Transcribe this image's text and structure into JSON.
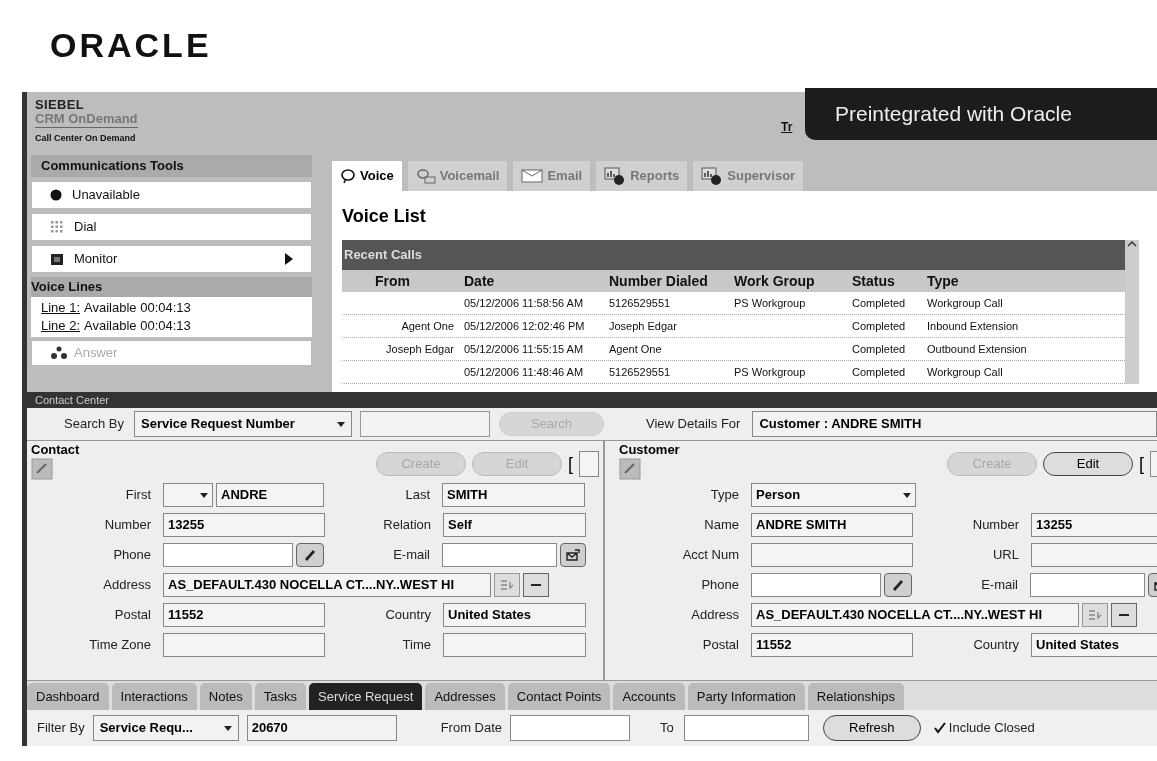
{
  "logo": "ORACLE",
  "header": {
    "brand": "SIEBEL",
    "product": "CRM OnDemand",
    "subtitle": "Call Center On Demand",
    "link_partial": "Tr",
    "banner": "Preintegrated with Oracle"
  },
  "comm_tools": {
    "title": "Communications Tools",
    "items": [
      {
        "label": "Unavailable",
        "kind": "status",
        "submenu": false
      },
      {
        "label": "Dial",
        "kind": "dial",
        "submenu": false
      },
      {
        "label": "Monitor",
        "kind": "monitor",
        "submenu": true
      }
    ]
  },
  "voice_lines": {
    "title": "Voice Lines",
    "lines": [
      {
        "link": "Line 1:",
        "status": "Available 00:04:13"
      },
      {
        "link": "Line 2:",
        "status": "Available 00:04:13"
      }
    ],
    "answer": {
      "label": "Answer",
      "disabled": true
    }
  },
  "tabs": [
    {
      "label": "Voice",
      "kind": "voice",
      "selected": true
    },
    {
      "label": "Voicemail",
      "kind": "voicemail",
      "selected": false
    },
    {
      "label": "Email",
      "kind": "email",
      "selected": false
    },
    {
      "label": "Reports",
      "kind": "reports",
      "selected": false
    },
    {
      "label": "Supervisor",
      "kind": "supervisor",
      "selected": false
    }
  ],
  "voice_list": {
    "title": "Voice List",
    "section": "Recent Calls",
    "columns": [
      "From",
      "Date",
      "Number Dialed",
      "Work Group",
      "Status",
      "Type"
    ],
    "rows": [
      [
        "",
        "05/12/2006 11:58:56 AM",
        "5126529551",
        "PS Workgroup",
        "Completed",
        "Workgroup Call"
      ],
      [
        "Agent One",
        "05/12/2006 12:02:46 PM",
        "Joseph Edgar",
        "",
        "Completed",
        "Inbound Extension"
      ],
      [
        "Joseph Edgar",
        "05/12/2006 11:55:15 AM",
        "Agent One",
        "",
        "Completed",
        "Outbound Extension"
      ],
      [
        "",
        "05/12/2006 11:48:46 AM",
        "5126529551",
        "PS Workgroup",
        "Completed",
        "Workgroup Call"
      ]
    ]
  },
  "contact_center": {
    "title": "Contact Center"
  },
  "search": {
    "label": "Search By",
    "select": "Service Request Number",
    "button": {
      "label": "Search",
      "disabled": true
    },
    "view_label": "View Details For",
    "view_value": "Customer : ANDRE SMITH"
  },
  "contact": {
    "title": "Contact",
    "bracket": "[",
    "buttons": [
      {
        "label": "Create",
        "disabled": true
      },
      {
        "label": "Edit",
        "disabled": true
      }
    ],
    "rows": [
      [
        {
          "label": "First",
          "kind": "name_select",
          "value": "ANDRE"
        },
        {
          "label": "Last",
          "kind": "text",
          "value": "SMITH"
        }
      ],
      [
        {
          "label": "Number",
          "kind": "text",
          "value": "13255"
        },
        {
          "label": "Relation",
          "kind": "text",
          "value": "Self"
        }
      ],
      [
        {
          "label": "Phone",
          "kind": "phone"
        },
        {
          "label": "E-mail",
          "kind": "email"
        }
      ],
      [
        {
          "label": "Address",
          "kind": "address",
          "value": "AS_DEFAULT.430 NOCELLA CT....NY..WEST HI"
        }
      ],
      [
        {
          "label": "Postal",
          "kind": "text",
          "value": "11552"
        },
        {
          "label": "Country",
          "kind": "text",
          "value": "United States"
        }
      ],
      [
        {
          "label": "Time Zone",
          "kind": "text"
        },
        {
          "label": "Time",
          "kind": "text"
        }
      ]
    ]
  },
  "customer": {
    "title": "Customer",
    "bracket": "[",
    "buttons": [
      {
        "label": "Create",
        "disabled": true
      },
      {
        "label": "Edit",
        "disabled": false
      }
    ],
    "rows": [
      [
        {
          "label": "Type",
          "kind": "select",
          "value": "Person"
        }
      ],
      [
        {
          "label": "Name",
          "kind": "text",
          "value": "ANDRE SMITH"
        },
        {
          "label": "Number",
          "kind": "text",
          "value": "13255"
        }
      ],
      [
        {
          "label": "Acct Num",
          "kind": "text"
        },
        {
          "label": "URL",
          "kind": "text"
        }
      ],
      [
        {
          "label": "Phone",
          "kind": "phone"
        },
        {
          "label": "E-mail",
          "kind": "email"
        }
      ],
      [
        {
          "label": "Address",
          "kind": "address",
          "value": "AS_DEFAULT.430 NOCELLA CT....NY..WEST HI"
        }
      ],
      [
        {
          "label": "Postal",
          "kind": "text",
          "value": "11552"
        },
        {
          "label": "Country",
          "kind": "text",
          "value": "United States"
        }
      ]
    ]
  },
  "bottom_tabs": [
    {
      "label": "Dashboard",
      "selected": false
    },
    {
      "label": "Interactions",
      "selected": false
    },
    {
      "label": "Notes",
      "selected": false
    },
    {
      "label": "Tasks",
      "selected": false
    },
    {
      "label": "Service Request",
      "selected": true
    },
    {
      "label": "Addresses",
      "selected": false
    },
    {
      "label": "Contact Points",
      "selected": false
    },
    {
      "label": "Accounts",
      "selected": false
    },
    {
      "label": "Party Information",
      "selected": false
    },
    {
      "label": "Relationships",
      "selected": false
    }
  ],
  "filter": {
    "label": "Filter By",
    "select": "Service Requ...",
    "value": "20670",
    "from_label": "From Date",
    "to_label": "To",
    "button": "Refresh",
    "include_closed": {
      "label": "Include Closed",
      "checked": true
    }
  }
}
